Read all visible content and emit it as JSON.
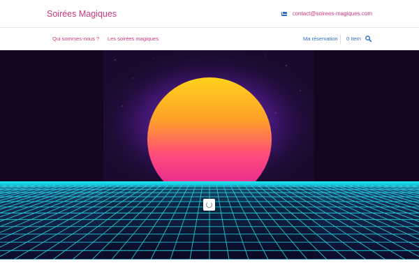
{
  "header": {
    "site_title": "Soirées Magiques",
    "contact_email": "contact@soirees-magiques.com",
    "contact_icon": "envelope-icon"
  },
  "nav": {
    "left_items": [
      {
        "label": "Qui sommes-nous ?"
      },
      {
        "label": "Les soirées magiques"
      }
    ],
    "reservation_label": "Ma réservation",
    "cart_label": "0 Item",
    "search_icon": "search-icon"
  },
  "hero": {
    "image_subject": "retro synthwave sunset over neon grid",
    "loading_icon": "loading-spinner-icon"
  },
  "colors": {
    "brand_pink": "#c8377f",
    "link_blue": "#2d6fc4",
    "grid_cyan": "#29e6f0",
    "background_dark": "#13051e"
  }
}
